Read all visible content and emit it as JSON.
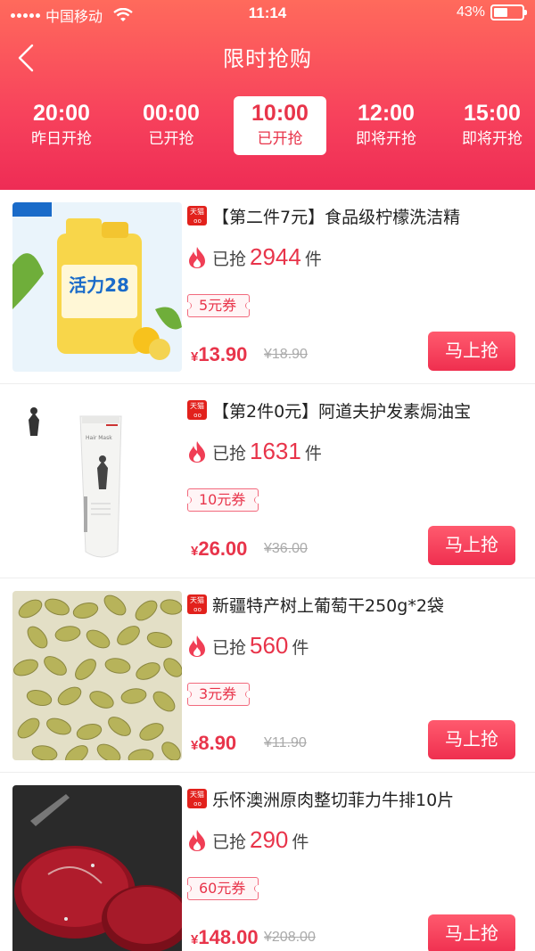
{
  "status_bar": {
    "carrier": "中国移动",
    "time": "11:14",
    "battery": "43%"
  },
  "header": {
    "title": "限时抢购"
  },
  "tabs": [
    {
      "time": "20:00",
      "state": "昨日开抢",
      "active": false
    },
    {
      "time": "00:00",
      "state": "已开抢",
      "active": false
    },
    {
      "time": "10:00",
      "state": "已开抢",
      "active": true
    },
    {
      "time": "12:00",
      "state": "即将开抢",
      "active": false
    },
    {
      "time": "15:00",
      "state": "即将开抢",
      "active": false
    }
  ],
  "products": [
    {
      "badge": "天猫",
      "title": "【第二件7元】食品级柠檬洗洁精",
      "sold_label": "已抢",
      "sold_count": "2944",
      "sold_unit": "件",
      "coupon": "5元券",
      "currency": "¥",
      "price": "13.90",
      "old_price": "¥18.90",
      "button": "马上抢",
      "image": "dish-soap-bottle"
    },
    {
      "badge": "天猫",
      "title": "【第2件0元】阿道夫护发素焗油宝",
      "sold_label": "已抢",
      "sold_count": "1631",
      "sold_unit": "件",
      "coupon": "10元券",
      "currency": "¥",
      "price": "26.00",
      "old_price": "¥36.00",
      "button": "马上抢",
      "image": "hair-mask-tube"
    },
    {
      "badge": "天猫",
      "title": "新疆特产树上葡萄干250g*2袋",
      "sold_label": "已抢",
      "sold_count": "560",
      "sold_unit": "件",
      "coupon": "3元券",
      "currency": "¥",
      "price": "8.90",
      "old_price": "¥11.90",
      "button": "马上抢",
      "image": "raisins"
    },
    {
      "badge": "天猫",
      "title": "乐怀澳洲原肉整切菲力牛排10片",
      "sold_label": "已抢",
      "sold_count": "290",
      "sold_unit": "件",
      "coupon": "60元券",
      "currency": "¥",
      "price": "148.00",
      "old_price": "¥208.00",
      "button": "马上抢",
      "image": "beef-steak"
    }
  ]
}
